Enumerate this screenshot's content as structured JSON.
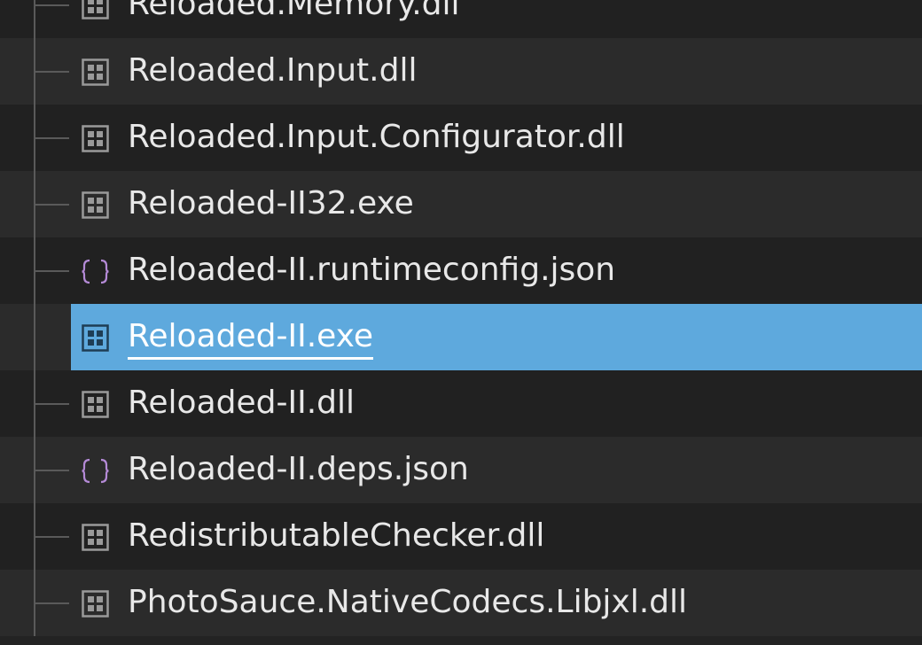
{
  "tree": {
    "items": [
      {
        "label": "Reloaded.Memory.dll",
        "icon": "binary-file-icon",
        "selected": false
      },
      {
        "label": "Reloaded.Input.dll",
        "icon": "binary-file-icon",
        "selected": false
      },
      {
        "label": "Reloaded.Input.Configurator.dll",
        "icon": "binary-file-icon",
        "selected": false
      },
      {
        "label": "Reloaded-II32.exe",
        "icon": "binary-file-icon",
        "selected": false
      },
      {
        "label": "Reloaded-II.runtimeconfig.json",
        "icon": "json-file-icon",
        "selected": false
      },
      {
        "label": "Reloaded-II.exe",
        "icon": "binary-file-icon",
        "selected": true
      },
      {
        "label": "Reloaded-II.dll",
        "icon": "binary-file-icon",
        "selected": false
      },
      {
        "label": "Reloaded-II.deps.json",
        "icon": "json-file-icon",
        "selected": false
      },
      {
        "label": "RedistributableChecker.dll",
        "icon": "binary-file-icon",
        "selected": false
      },
      {
        "label": "PhotoSauce.NativeCodecs.Libjxl.dll",
        "icon": "binary-file-icon",
        "selected": false
      }
    ]
  },
  "colors": {
    "selection": "#5ea9dd",
    "json_icon": "#b48ad6",
    "binary_icon": "#9a9a9a"
  }
}
